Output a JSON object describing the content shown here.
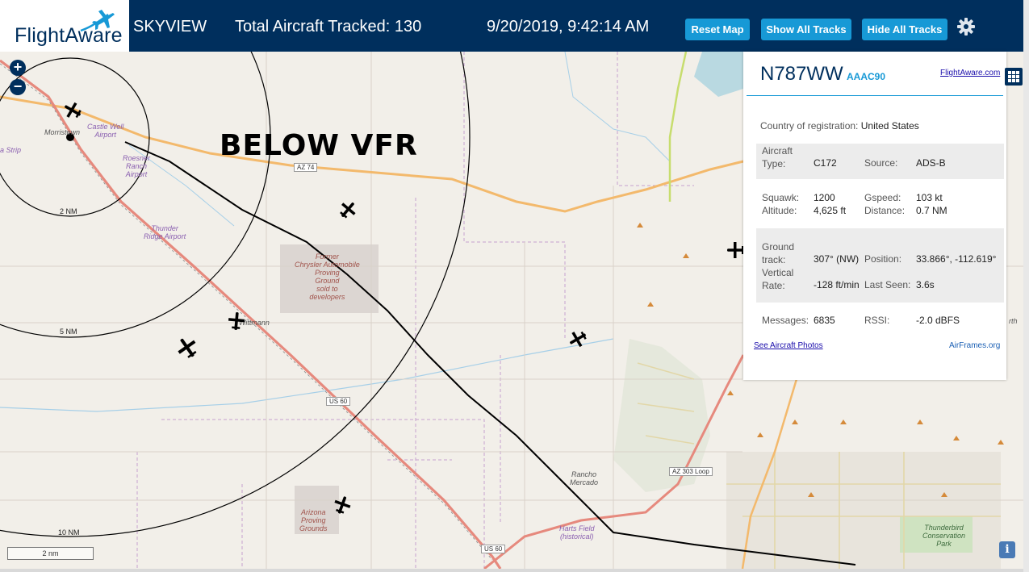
{
  "header": {
    "logo_text": "FlightAware",
    "app_name": "SKYVIEW",
    "aircraft_count_label": "Total Aircraft Tracked: 130",
    "datetime": "9/20/2019, 9:42:14 AM",
    "buttons": {
      "reset": "Reset Map",
      "show_tracks": "Show All Tracks",
      "hide_tracks": "Hide All Tracks"
    },
    "settings_icon": "gear-icon",
    "colors": {
      "header_bg": "#002f5d",
      "button_bg": "#1799d6"
    }
  },
  "map": {
    "overlay_label": "BELOW VFR",
    "range_labels": [
      "2 NM",
      "5 NM",
      "10 NM"
    ],
    "scale_label": "2 nm",
    "zoom_in_label": "+",
    "zoom_out_label": "−",
    "places": {
      "morristown": "Morristown",
      "castle_well": "Castle Well\nAirport",
      "strip": "a Strip",
      "roesner": "Roesner\nRanch\nAirport",
      "thunder": "Thunder\nRidge Airport",
      "wittmann": "Wittmann",
      "chrysler": "Former\nChrysler Automobile\nProving\nGround\nsold to\ndevelopers",
      "arizona_pg": "Arizona\nProving\nGrounds",
      "rancho": "Rancho\nMercado",
      "harts": "Harts Field\n(historical)",
      "thunderbird": "Thunderbird\nConservation\nPark",
      "north": "rth"
    },
    "roads": {
      "az74": "AZ 74",
      "us60a": "US 60",
      "us60b": "US 60",
      "az303": "AZ 303 Loop"
    },
    "info_label": "i"
  },
  "selected_aircraft": {
    "tail": "N787WW",
    "hex": "AAAC90",
    "link": "FlightAware.com",
    "country_label": "Country of registration:",
    "country": "United States",
    "aircraft_type_label": "Aircraft\nType:",
    "aircraft_type": "C172",
    "source_label": "Source:",
    "source": "ADS-B",
    "squawk_label": "Squawk:",
    "squawk": "1200",
    "gspeed_label": "Gspeed:",
    "gspeed": "103 kt",
    "altitude_label": "Altitude:",
    "altitude": "4,625 ft",
    "distance_label": "Distance:",
    "distance": "0.7 NM",
    "ground_track_label": "Ground\ntrack:",
    "ground_track": "307° (NW)",
    "position_label": "Position:",
    "position": "33.866°, -112.619°",
    "vertical_rate_label": "Vertical\nRate:",
    "vertical_rate": "-128 ft/min",
    "last_seen_label": "Last Seen:",
    "last_seen": "3.6s",
    "messages_label": "Messages:",
    "messages": "6835",
    "rssi_label": "RSSI:",
    "rssi": "-2.0 dBFS",
    "photos_link": "See Aircraft Photos",
    "airframes_link": "AirFrames.org"
  }
}
